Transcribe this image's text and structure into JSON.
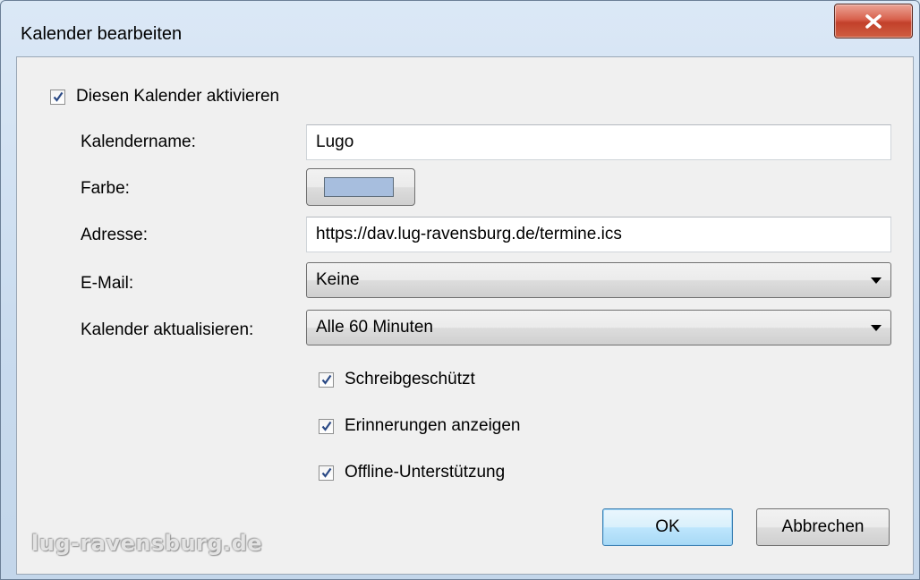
{
  "window": {
    "title": "Kalender bearbeiten"
  },
  "enable": {
    "label": "Diesen Kalender aktivieren",
    "checked": true
  },
  "form": {
    "name_label": "Kalendername:",
    "name_value": "Lugo",
    "color_label": "Farbe:",
    "color_value": "#a7bede",
    "address_label": "Adresse:",
    "address_value": "https://dav.lug-ravensburg.de/termine.ics",
    "email_label": "E-Mail:",
    "email_value": "Keine",
    "refresh_label": "Kalender aktualisieren:",
    "refresh_value": "Alle 60 Minuten"
  },
  "options": {
    "readonly_label": "Schreibgeschützt",
    "reminders_label": "Erinnerungen anzeigen",
    "offline_label": "Offline-Unterstützung"
  },
  "buttons": {
    "ok": "OK",
    "cancel": "Abbrechen"
  },
  "watermark": "lug-ravensburg.de",
  "icons": {
    "close": "close-icon",
    "check": "checkmark-icon",
    "dropdown": "dropdown-arrow-icon"
  }
}
